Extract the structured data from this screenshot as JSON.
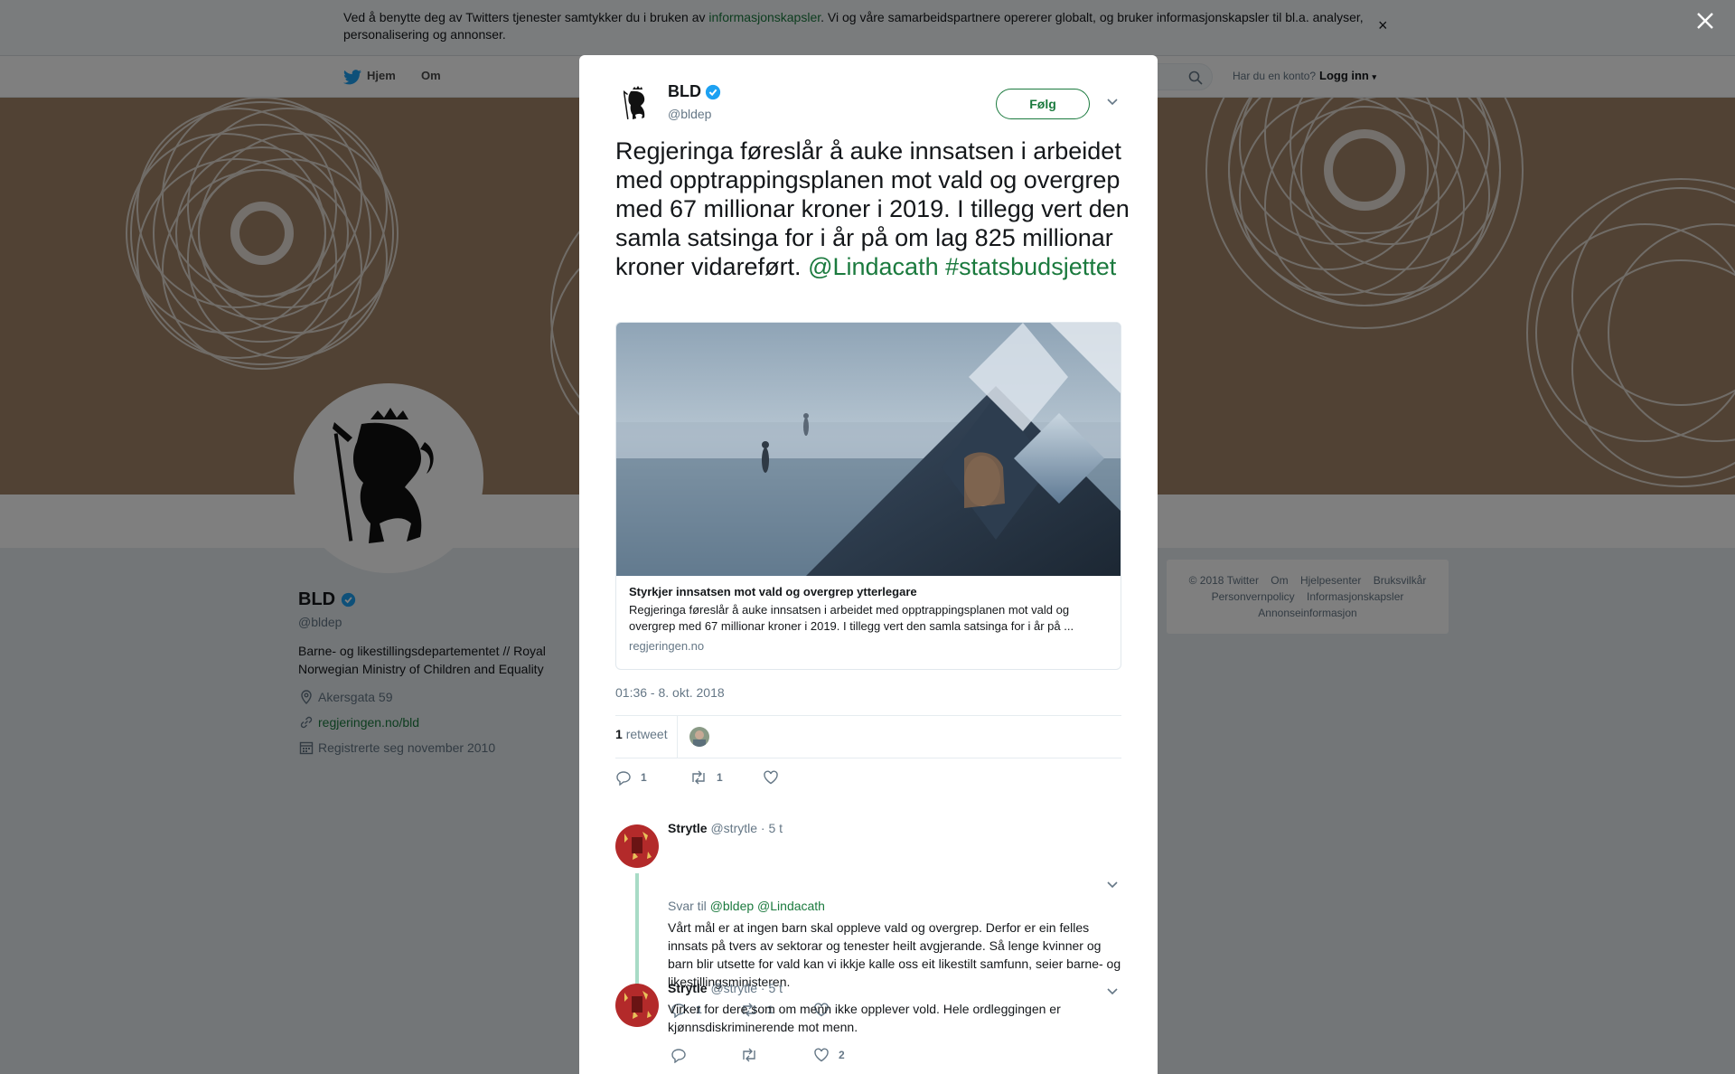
{
  "cookie": {
    "text_before": "Ved å benytte deg av Twitters tjenester samtykker du i bruken av ",
    "link": "informasjonskapsler",
    "text_after": ". Vi og våre samarbeidspartnere opererer globalt, og bruker informasjonskapsler til bl.a. analyser, personalisering og annonser.",
    "close": "×"
  },
  "nav": {
    "home": "Hjem",
    "about": "Om",
    "have_account": "Har du en konto?",
    "login": "Logg inn"
  },
  "profile": {
    "name": "BLD",
    "handle": "@bldep",
    "bio": "Barne- og likestillingsdepartementet // Royal Norwegian Ministry of Children and Equality",
    "location": "Akersgata 59",
    "website": "regjeringen.no/bld",
    "joined": "Registrerte seg november 2010"
  },
  "footer": {
    "items": [
      "© 2018 Twitter",
      "Om",
      "Hjelpesenter",
      "Bruksvilkår",
      "Personvernpolicy",
      "Informasjonskapsler",
      "Annonseinformasjon"
    ]
  },
  "modal": {
    "name": "BLD",
    "handle": "@bldep",
    "follow": "Følg",
    "tweet_text": "Regjeringa føreslår å auke innsatsen i arbeidet med opptrappingsplanen mot vald og overgrep med 67 millionar kroner i 2019. I tillegg vert den samla satsinga for i år på om lag 825 millionar kroner vidareført.",
    "mention": "@Lindacath",
    "hashtag": "#statsbudsjettet",
    "card": {
      "title": "Styrkjer innsatsen mot vald og overgrep ytterlegare",
      "description": "Regjeringa føreslår å auke innsatsen i arbeidet med opptrappingsplanen mot vald og overgrep med 67 millionar kroner i 2019. I tillegg vert den samla satsinga for i år på ...",
      "url": "regjeringen.no"
    },
    "timestamp": "01:36 - 8. okt. 2018",
    "retweet_count": "1",
    "retweet_label": "retweet",
    "actions": {
      "replies": "1",
      "retweets": "1"
    }
  },
  "replies": [
    {
      "name": "Strytle",
      "handle": "@strytle",
      "time": "· 5 t",
      "reply_to_label": "Svar til",
      "reply_to": "@bldep @Lindacath",
      "text": "Vårt mål er at ingen barn skal oppleve vald og overgrep. Derfor er ein felles innsats på tvers av sektorar og tenester heilt avgjerande. Så lenge kvinner og barn blir utsette for vald kan vi ikkje kalle oss eit likestilt samfunn, seier barne- og likestillingsministeren.",
      "replies": "1",
      "retweets": "1",
      "likes": ""
    },
    {
      "name": "Strytle",
      "handle": "@strytle",
      "time": "· 5 t",
      "text": "Virker for dere som om menn ikke opplever vold. Hele ordleggingen er kjønnsdiskriminerende mot menn.",
      "replies": "",
      "retweets": "",
      "likes": "2"
    }
  ],
  "colors": {
    "link": "#1b7a3e",
    "verified": "#1da1f2",
    "banner": "#a28468"
  }
}
